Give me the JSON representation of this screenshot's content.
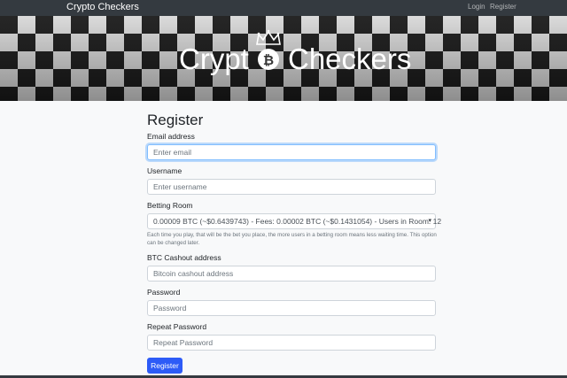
{
  "navbar": {
    "brand": "Crypto Checkers",
    "links": [
      {
        "label": "Login"
      },
      {
        "label": "Register"
      }
    ]
  },
  "banner": {
    "logo_text_left": "Crypt",
    "logo_text_right": "Checkers",
    "logo_coin_glyph": "₿",
    "icons": [
      "crown-icon",
      "bitcoin-icon"
    ]
  },
  "form": {
    "title": "Register",
    "email": {
      "label": "Email address",
      "placeholder": "Enter email"
    },
    "username": {
      "label": "Username",
      "placeholder": "Enter username"
    },
    "betting_room": {
      "label": "Betting Room",
      "selected": "0.00009 BTC (~$0.6439743) - Fees: 0.00002 BTC (~$0.1431054) - Users in Room: 12",
      "help": "Each time you play, that will be the bet you place, the more users in a betting room means less waiting time. This option can be changed later."
    },
    "btc_address": {
      "label": "BTC Cashout address",
      "placeholder": "Bitcoin cashout address"
    },
    "password": {
      "label": "Password",
      "placeholder": "Password"
    },
    "repeat_password": {
      "label": "Repeat Password",
      "placeholder": "Repeat Password"
    },
    "submit_label": "Register"
  },
  "colors": {
    "navbar_bg": "#343a40",
    "primary_button": "#2d5bf7",
    "focus_border": "#80bdff",
    "page_bg": "#f8f9fa"
  }
}
